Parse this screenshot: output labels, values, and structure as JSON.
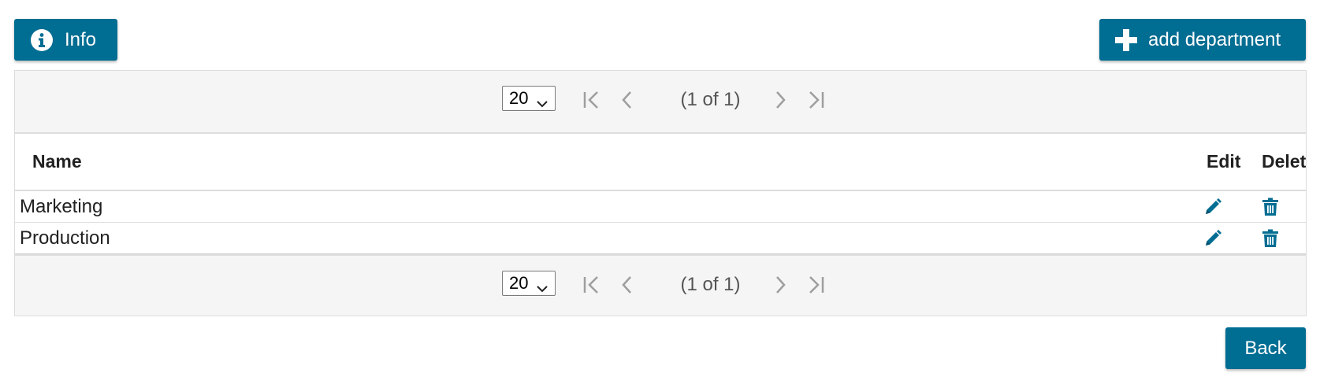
{
  "toolbar": {
    "info_label": "Info",
    "add_label": "add department",
    "back_label": "Back"
  },
  "paginator": {
    "rows_per_page": "20",
    "report": "(1 of 1)"
  },
  "table": {
    "columns": {
      "name": "Name",
      "edit": "Edit",
      "delete": "Delet"
    },
    "rows": [
      {
        "name": "Marketing"
      },
      {
        "name": "Production"
      }
    ]
  },
  "icons": {
    "info": "info-circle-icon",
    "add": "plus-icon",
    "edit": "pencil-icon",
    "delete": "trash-icon",
    "first": "first-page-icon",
    "prev": "previous-page-icon",
    "next": "next-page-icon",
    "last": "last-page-icon",
    "dropdown": "chevron-down-icon"
  },
  "colors": {
    "primary": "#006d92",
    "paginator_bg": "#f4f5f4",
    "border": "#dcdcdc",
    "pager_icon": "#9e9e9e"
  }
}
